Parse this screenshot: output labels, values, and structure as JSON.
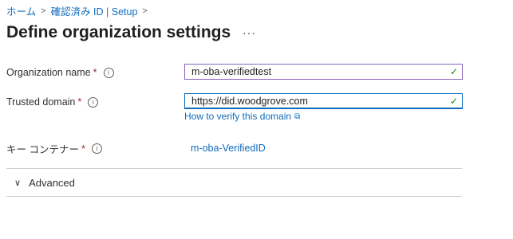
{
  "breadcrumb": {
    "items": [
      "ホーム",
      "確認済み ID | Setup"
    ],
    "separator": ">"
  },
  "page": {
    "title": "Define organization settings",
    "more_icon": "ellipsis-icon",
    "more_glyph": "···"
  },
  "form": {
    "organization_name": {
      "label": "Organization name",
      "required": "*",
      "info": "i",
      "value": "m-oba-verifiedtest",
      "valid_glyph": "✓"
    },
    "trusted_domain": {
      "label": "Trusted domain",
      "required": "*",
      "info": "i",
      "value": "https://did.woodgrove.com",
      "valid_glyph": "✓",
      "help_link": "How to verify this domain",
      "help_link_icon": "⧉"
    },
    "key_container": {
      "label": "キー コンテナー",
      "required": "*",
      "info": "i",
      "value": "m-oba-VerifiedID"
    }
  },
  "advanced": {
    "label": "Advanced",
    "chevron": "∨",
    "expanded": false
  },
  "colors": {
    "link": "#0f6cbd",
    "required": "#a4262c",
    "valid": "#107c10",
    "focus_border": "#0f6cbd",
    "field_border": "#8764b8"
  }
}
